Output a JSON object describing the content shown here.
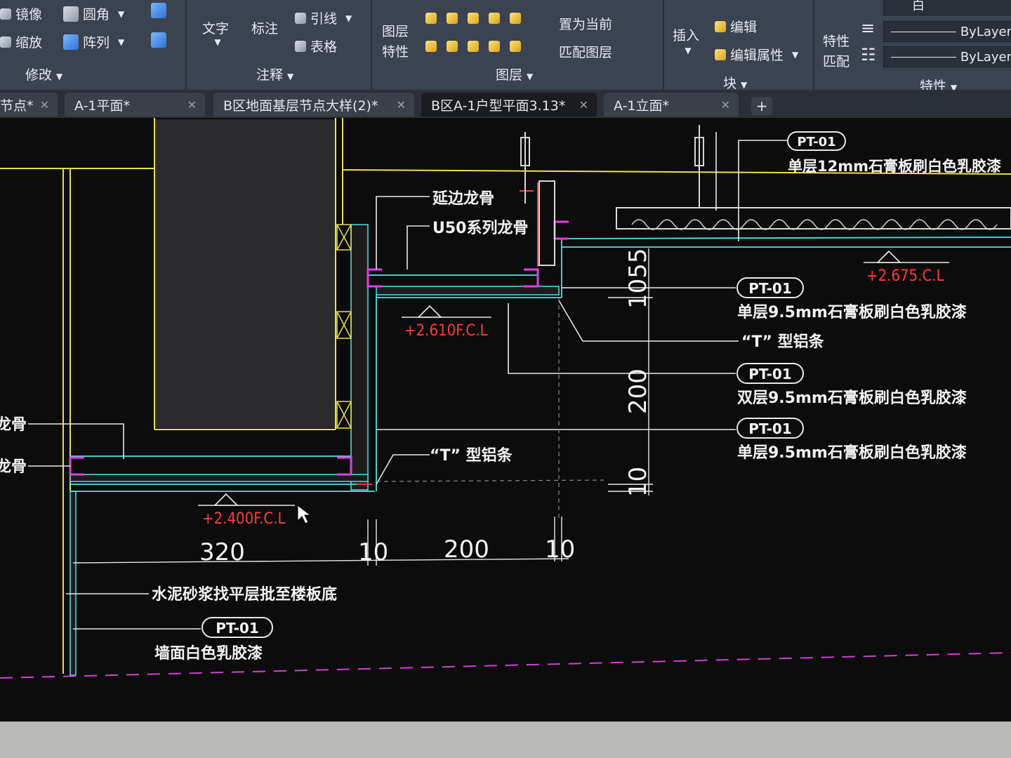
{
  "ribbon": {
    "modify": {
      "mirror": "镜像",
      "fillet": "圆角",
      "scale": "缩放",
      "array": "阵列",
      "panel_label": "修改"
    },
    "annotation": {
      "text": "文字",
      "dimension": "标注",
      "leader": "引线",
      "table": "表格",
      "panel_label": "注释"
    },
    "layers": {
      "layer_properties_line1": "图层",
      "layer_properties_line2": "特性",
      "set_current": "置为当前",
      "match_layer": "匹配图层",
      "panel_label": "图层"
    },
    "block": {
      "insert": "插入",
      "edit": "编辑",
      "edit_attributes": "编辑属性",
      "panel_label": "块"
    },
    "properties": {
      "match_line1": "特性",
      "match_line2": "匹配",
      "color_value": "白",
      "linetype_value": "ByLayer",
      "lineweight_value": "ByLayer",
      "panel_label": "特性"
    }
  },
  "tabs": [
    {
      "label": "节点*"
    },
    {
      "label": "A-1平面*"
    },
    {
      "label": "B区地面基层节点大样(2)*"
    },
    {
      "label": "B区A-1户型平面3.13*"
    },
    {
      "label": "A-1立面*"
    }
  ],
  "new_tab_label": "+",
  "drawing": {
    "labels": {
      "edge_keel": "延边龙骨",
      "u50_keel": "U50系列龙骨",
      "pt01": "PT-01",
      "top_right_desc": "单层12mm石膏板刷白色乳胶漆",
      "single_95_desc": "单层9.5mm石膏板刷白色乳胶漆",
      "double_95_desc": "双层9.5mm石膏板刷白色乳胶漆",
      "t_strip": "“T” 型铝条",
      "left_keel_1": "龙骨",
      "left_keel_2": "龙骨",
      "cement_mortar": "水泥砂浆找平层批至楼板底",
      "wall_paint": "墙面白色乳胶漆"
    },
    "levels": {
      "level_2610": "+2.610F.C.L",
      "level_2400": "+2.400F.C.L",
      "level_2675": "+2.675.C.L"
    },
    "dimensions": {
      "d320": "320",
      "d10a": "10",
      "d200h": "200",
      "d10b": "10",
      "d1055": "1055",
      "d200v": "200",
      "d10v": "10"
    },
    "colors": {
      "yellow": "#e8e04a",
      "cyan": "#52e0e0",
      "magenta": "#e040e0",
      "red": "#ff3a3a",
      "white": "#f2f2f2"
    }
  }
}
